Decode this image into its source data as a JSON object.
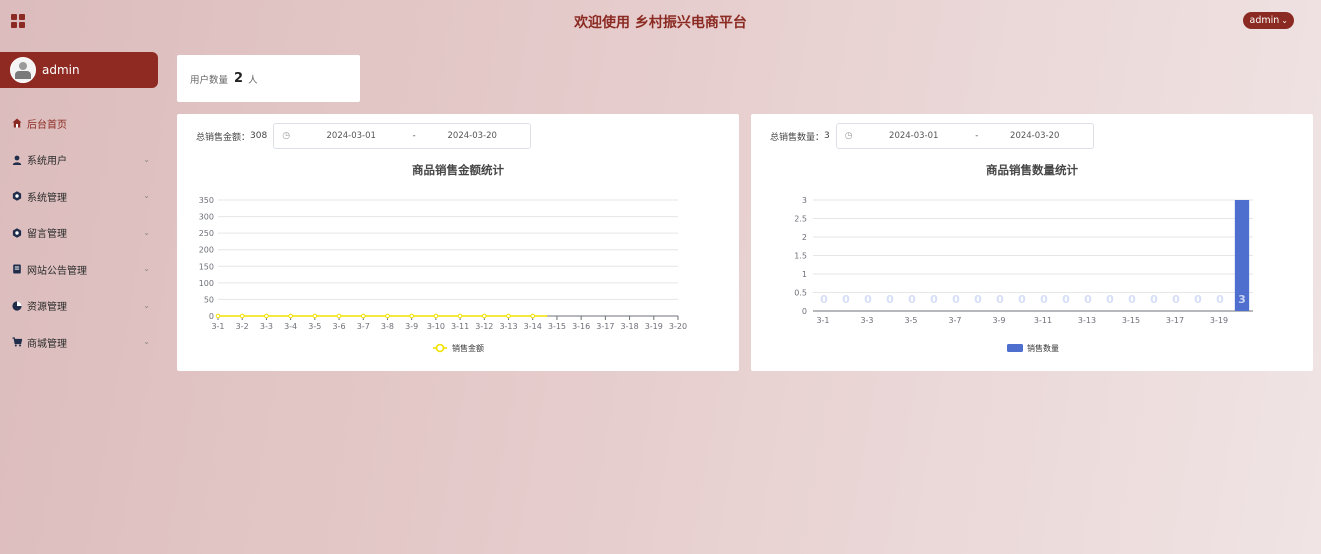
{
  "header": {
    "title": "欢迎使用 乡村振兴电商平台",
    "user": "admin"
  },
  "sidebar": {
    "profile_name": "admin",
    "items": [
      {
        "label": "后台首页",
        "icon": "home-icon"
      },
      {
        "label": "系统用户",
        "icon": "user-icon"
      },
      {
        "label": "系统管理",
        "icon": "settings-icon"
      },
      {
        "label": "留言管理",
        "icon": "message-icon"
      },
      {
        "label": "网站公告管理",
        "icon": "notice-icon"
      },
      {
        "label": "资源管理",
        "icon": "pie-chart-icon"
      },
      {
        "label": "商城管理",
        "icon": "cart-icon"
      }
    ]
  },
  "stats": {
    "users_label": "用户数量",
    "users_value": "2",
    "users_unit": "人"
  },
  "sales_amount": {
    "label": "总销售金额：",
    "value": "308",
    "date_from": "2024-03-01",
    "date_to": "2024-03-20",
    "date_sep": "-"
  },
  "sales_count": {
    "label": "总销售数量：",
    "value": "3",
    "date_from": "2024-03-01",
    "date_to": "2024-03-20",
    "date_sep": "-"
  },
  "colors": {
    "accent": "#8b2a22",
    "line": "#f2e200",
    "bar": "#4f6fcf"
  },
  "chart_data": [
    {
      "type": "line",
      "title": "商品销售金额统计",
      "categories": [
        "3-1",
        "3-2",
        "3-3",
        "3-4",
        "3-5",
        "3-6",
        "3-7",
        "3-8",
        "3-9",
        "3-10",
        "3-11",
        "3-12",
        "3-13",
        "3-14",
        "3-15",
        "3-16",
        "3-17",
        "3-18",
        "3-19",
        "3-20"
      ],
      "series": [
        {
          "name": "销售金额",
          "values": [
            0,
            0,
            0,
            0,
            0,
            0,
            0,
            0,
            0,
            0,
            0,
            0,
            0,
            0,
            null,
            null,
            null,
            null,
            null,
            null
          ]
        }
      ],
      "ylim": [
        0,
        350
      ],
      "yticks": [
        0,
        50,
        100,
        150,
        200,
        250,
        300,
        350
      ],
      "grid": true,
      "legend": "bottom"
    },
    {
      "type": "bar",
      "title": "商品销售数量统计",
      "categories": [
        "3-1",
        "3-2",
        "3-3",
        "3-4",
        "3-5",
        "3-6",
        "3-7",
        "3-8",
        "3-9",
        "3-10",
        "3-11",
        "3-12",
        "3-13",
        "3-14",
        "3-15",
        "3-16",
        "3-17",
        "3-18",
        "3-19",
        "3-20"
      ],
      "xtick_labels": [
        "3-1",
        "3-3",
        "3-5",
        "3-7",
        "3-9",
        "3-11",
        "3-13",
        "3-15",
        "3-17",
        "3-19"
      ],
      "series": [
        {
          "name": "销售数量",
          "values": [
            0,
            0,
            0,
            0,
            0,
            0,
            0,
            0,
            0,
            0,
            0,
            0,
            0,
            0,
            0,
            0,
            0,
            0,
            0,
            3
          ]
        }
      ],
      "ylim": [
        0,
        3
      ],
      "yticks": [
        "0",
        "0.5",
        "1",
        "1.5",
        "2",
        "2.5",
        "3"
      ],
      "grid": true,
      "legend": "bottom"
    }
  ]
}
